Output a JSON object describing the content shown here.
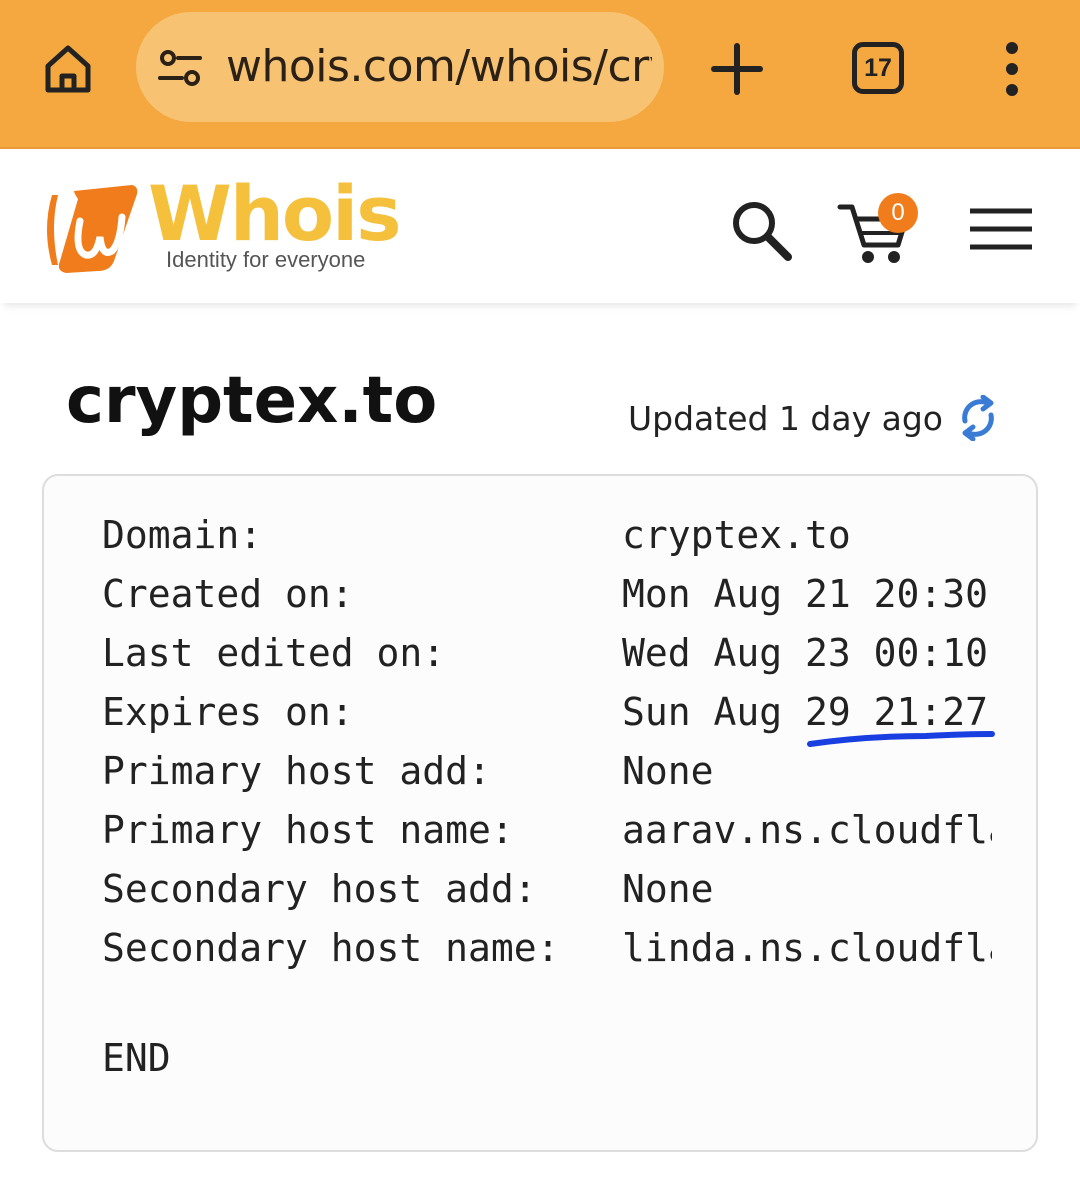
{
  "browser": {
    "url": "whois.com/whois/cryptex.to",
    "tab_count": "17",
    "toolbar_color": "#f4a83f",
    "url_pill_color": "#f8c273"
  },
  "site": {
    "logo_word": "Whois",
    "tagline": "Identity for everyone",
    "cart_count": "0",
    "brand_orange": "#f07c1b",
    "brand_yellow": "#f5c03b"
  },
  "content": {
    "title": "cryptex.to",
    "updated": "Updated 1 day ago",
    "rows": [
      {
        "label": "Domain:",
        "value": "cryptex.to"
      },
      {
        "label": "Created on:",
        "value": "Mon Aug 21 20:30"
      },
      {
        "label": "Last edited on:",
        "value": "Wed Aug 23 00:10"
      },
      {
        "label": "Expires on:",
        "value": "Sun Aug 29 21:27"
      },
      {
        "label": "Primary host add:",
        "value": "None"
      },
      {
        "label": "Primary host name:",
        "value": "aarav.ns.cloudflare.com"
      },
      {
        "label": "Secondary host add:",
        "value": "None"
      },
      {
        "label": "Secondary host name:",
        "value": "linda.ns.cloudflare.com"
      }
    ],
    "end": "END",
    "annotation_color": "#1a3fe0"
  }
}
